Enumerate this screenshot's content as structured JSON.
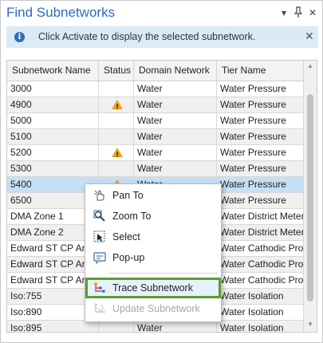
{
  "window": {
    "title": "Find Subnetworks",
    "controls": [
      "chevron-down-icon",
      "pin-icon",
      "close-icon"
    ]
  },
  "banner": {
    "text": "Click Activate to display the selected subnetwork."
  },
  "table": {
    "columns": [
      "Subnetwork Name",
      "Status",
      "Domain Network",
      "Tier Name"
    ],
    "rows": [
      {
        "name": "3000",
        "status": "",
        "domain": "Water",
        "tier": "Water Pressure"
      },
      {
        "name": "4900",
        "status": "warning",
        "domain": "Water",
        "tier": "Water Pressure"
      },
      {
        "name": "5000",
        "status": "",
        "domain": "Water",
        "tier": "Water Pressure"
      },
      {
        "name": "5100",
        "status": "",
        "domain": "Water",
        "tier": "Water Pressure"
      },
      {
        "name": "5200",
        "status": "warning",
        "domain": "Water",
        "tier": "Water Pressure"
      },
      {
        "name": "5300",
        "status": "",
        "domain": "Water",
        "tier": "Water Pressure"
      },
      {
        "name": "5400",
        "status": "warning",
        "domain": "Water",
        "tier": "Water Pressure"
      },
      {
        "name": "6500",
        "status": "",
        "domain": "Water",
        "tier": "Water Pressure"
      },
      {
        "name": "DMA Zone 1",
        "status": "",
        "domain": "",
        "tier": "Water District Metered"
      },
      {
        "name": "DMA Zone 2",
        "status": "",
        "domain": "",
        "tier": "Water District Metered"
      },
      {
        "name": "Edward ST CP Area",
        "status": "",
        "domain": "",
        "tier": "Water Cathodic Protection"
      },
      {
        "name": "Edward ST CP Area",
        "status": "",
        "domain": "",
        "tier": "Water Cathodic Protection"
      },
      {
        "name": "Edward ST CP Area",
        "status": "",
        "domain": "",
        "tier": "Water Cathodic Protection"
      },
      {
        "name": "Iso:755",
        "status": "",
        "domain": "",
        "tier": "Water Isolation"
      },
      {
        "name": "Iso:890",
        "status": "",
        "domain": "",
        "tier": "Water Isolation"
      },
      {
        "name": "Iso:895",
        "status": "",
        "domain": "Water",
        "tier": "Water Isolation"
      }
    ],
    "selected_row": 6
  },
  "context_menu": {
    "items": [
      {
        "label": "Pan To",
        "icon": "pan-icon",
        "enabled": true
      },
      {
        "label": "Zoom To",
        "icon": "zoom-icon",
        "enabled": true
      },
      {
        "label": "Select",
        "icon": "select-icon",
        "enabled": true
      },
      {
        "label": "Pop-up",
        "icon": "popup-icon",
        "enabled": true
      },
      {
        "label": "Trace Subnetwork",
        "icon": "trace-icon",
        "enabled": true
      },
      {
        "label": "Update Subnetwork",
        "icon": "update-icon",
        "enabled": false
      }
    ],
    "highlighted_item": 4
  },
  "colors": {
    "accent": "#2b6cb8",
    "banner_bg": "#dbeaf7",
    "selection": "#c5dff5",
    "warning": "#e8a21e",
    "highlight_border": "#5b9b2f"
  }
}
